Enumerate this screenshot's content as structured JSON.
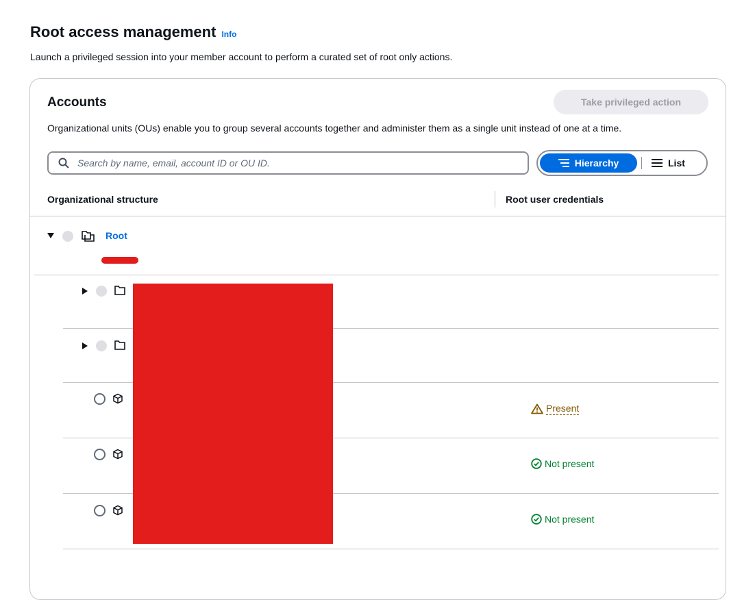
{
  "header": {
    "title": "Root access management",
    "info_label": "Info",
    "description": "Launch a privileged session into your member account to perform a curated set of root only actions."
  },
  "accounts_panel": {
    "title": "Accounts",
    "action_button_label": "Take privileged action",
    "description": "Organizational units (OUs) enable you to group several accounts together and administer them as a single unit instead of one at a time.",
    "search": {
      "placeholder": "Search by name, email, account ID or OU ID.",
      "value": ""
    },
    "view_toggle": {
      "hierarchy_label": "Hierarchy",
      "list_label": "List",
      "selected": "Hierarchy"
    },
    "columns": {
      "structure": "Organizational structure",
      "credentials": "Root user credentials"
    },
    "tree": {
      "root": {
        "label": "Root",
        "expanded": true
      },
      "rows": [
        {
          "type": "ou",
          "expanded": false,
          "status": ""
        },
        {
          "type": "ou",
          "expanded": false,
          "status": ""
        },
        {
          "type": "account",
          "status": "Present",
          "status_kind": "warning"
        },
        {
          "type": "account",
          "status": "Not present",
          "status_kind": "success"
        },
        {
          "type": "account",
          "status": "Not present",
          "status_kind": "success"
        }
      ]
    }
  },
  "colors": {
    "accent": "#006ce0",
    "warning": "#855900",
    "success": "#00802f",
    "redaction": "#e31c1c"
  },
  "icons": [
    "search-icon",
    "hierarchy-icon",
    "list-icon",
    "caret-down-icon",
    "caret-right-icon",
    "org-root-icon",
    "ou-folder-icon",
    "account-cube-icon",
    "warning-icon",
    "check-circle-icon"
  ]
}
